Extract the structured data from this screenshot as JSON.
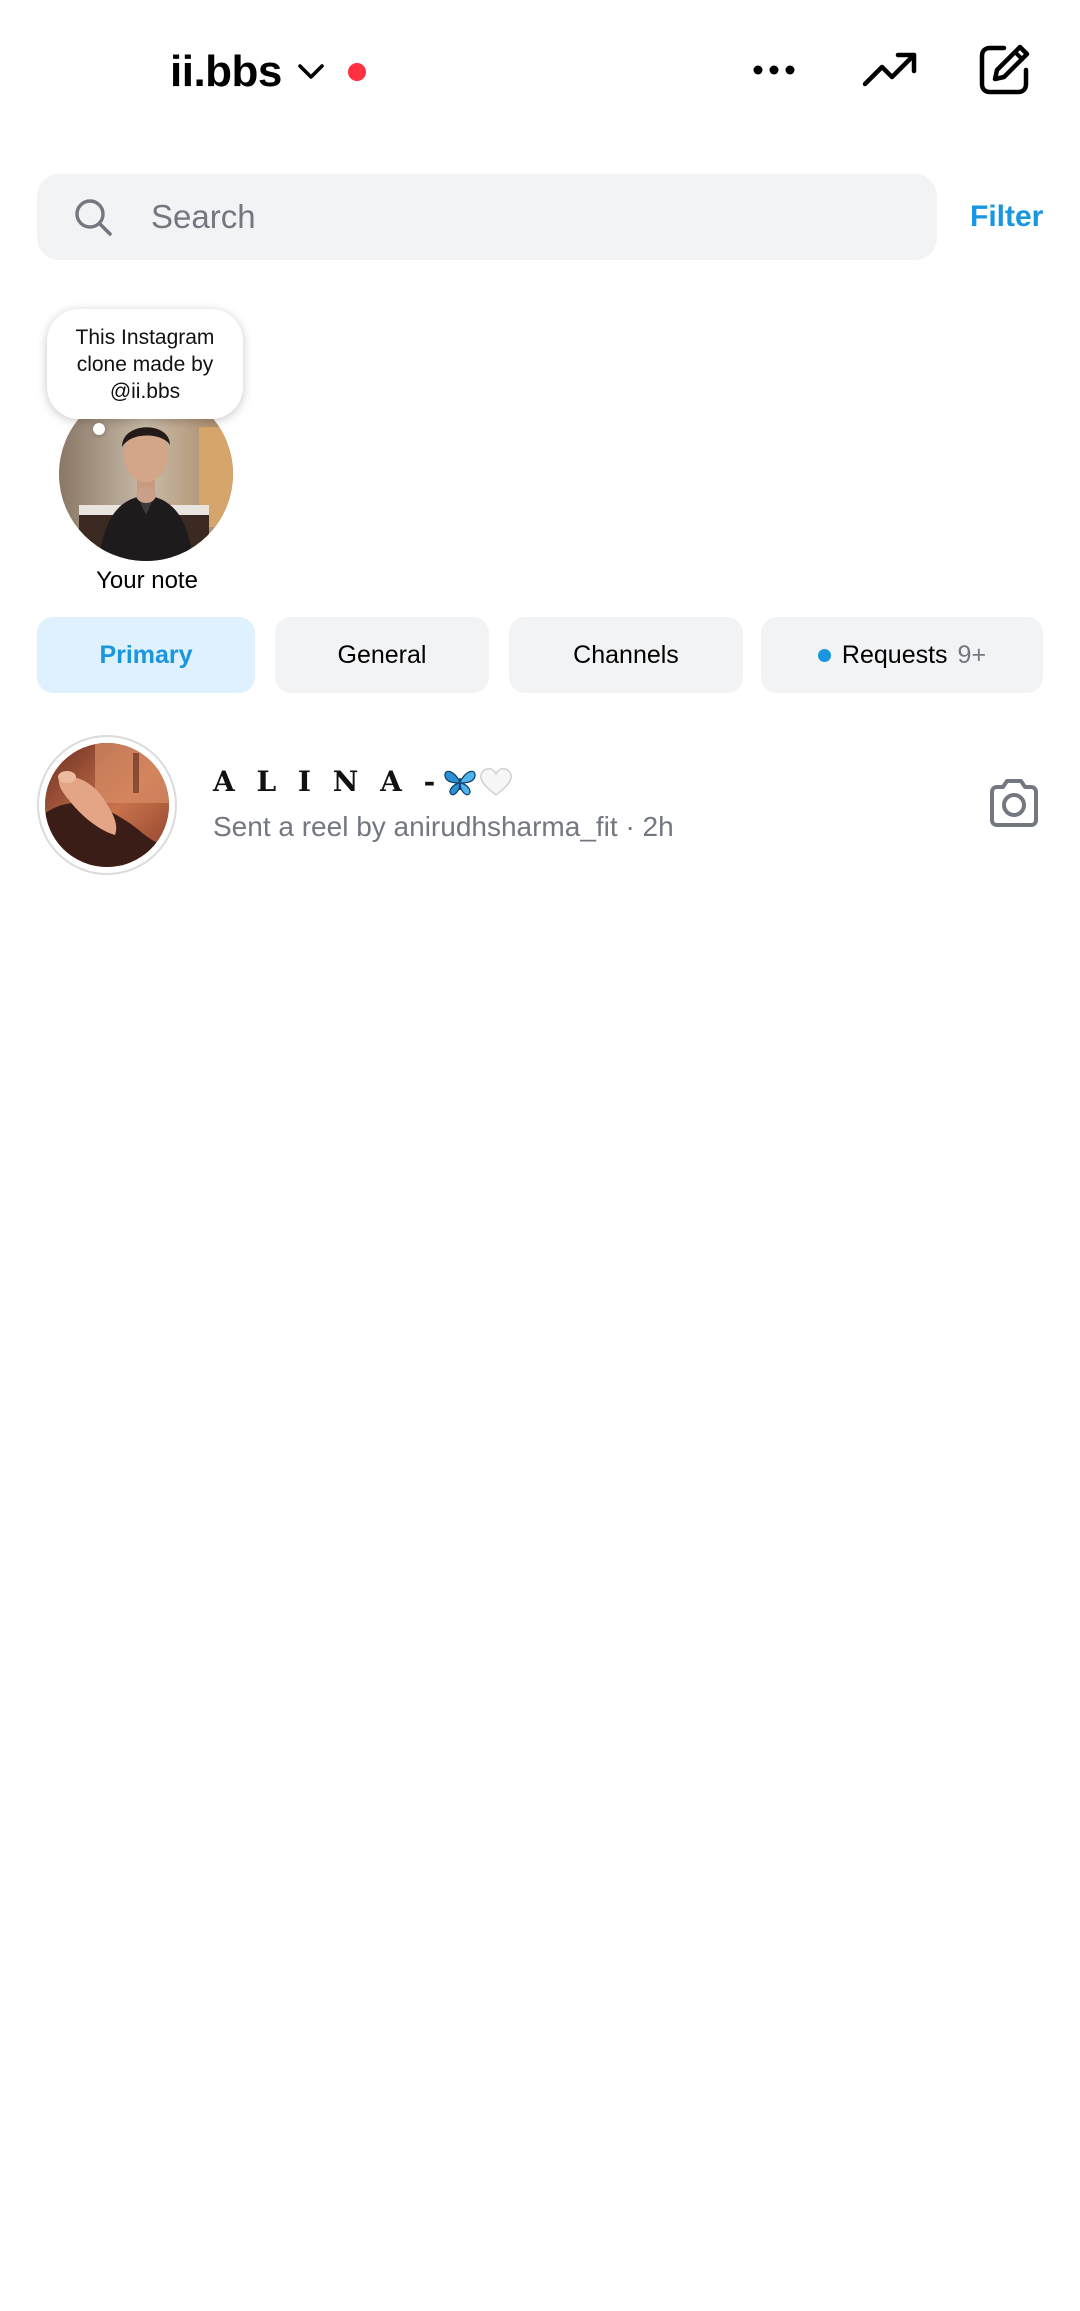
{
  "header": {
    "username": "ii.bbs",
    "icons": {
      "switch": "chevron-down-icon",
      "status": "status-dot",
      "more": "more-horizontal-icon",
      "trending": "trending-up-icon",
      "compose": "compose-icon"
    },
    "status_color": "#ff3040"
  },
  "search": {
    "placeholder": "Search",
    "value": "",
    "filter_label": "Filter"
  },
  "note": {
    "text": "This Instagram clone made by @ii.bbs",
    "label": "Your note"
  },
  "tabs": [
    {
      "label": "Primary",
      "active": true
    },
    {
      "label": "General",
      "active": false
    },
    {
      "label": "Channels",
      "active": false
    },
    {
      "label": "Requests",
      "count": "9+",
      "active": false
    }
  ],
  "conversations": [
    {
      "name": "A L I N A -",
      "name_emojis": [
        "butterfly-icon",
        "white-heart-icon"
      ],
      "preview": "Sent a reel by anirudhsharma_fit · 2h",
      "action_icon": "camera-icon"
    }
  ],
  "colors": {
    "accent": "#1a95e0",
    "muted_text": "#737780",
    "pill_bg": "#f2f3f5",
    "active_pill_bg": "#dff1fd"
  }
}
